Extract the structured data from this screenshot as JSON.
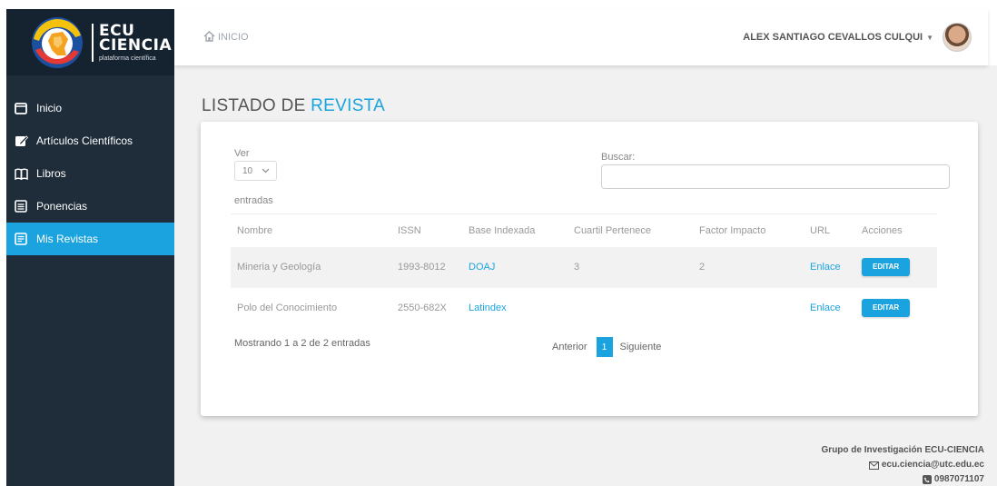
{
  "brand": {
    "line1": "ECU",
    "line2": "CIENCIA",
    "tagline": "plataforma científica"
  },
  "sidebar": {
    "items": [
      {
        "label": "Inicio",
        "icon": "square-icon"
      },
      {
        "label": "Artículos Científicos",
        "icon": "edit-icon"
      },
      {
        "label": "Libros",
        "icon": "book-icon"
      },
      {
        "label": "Ponencias",
        "icon": "list-icon"
      },
      {
        "label": "Mis Revistas",
        "icon": "document-icon",
        "active": true
      }
    ]
  },
  "header": {
    "breadcrumb": "INICIO",
    "user_name": "ALEX SANTIAGO CEVALLOS CULQUI"
  },
  "page": {
    "title_prefix": "LISTADO DE",
    "title_accent": "REVISTA"
  },
  "controls": {
    "show_label": "Ver",
    "page_size": "10",
    "entries_label": "entradas",
    "search_label": "Buscar:",
    "search_value": ""
  },
  "table": {
    "columns": [
      "Nombre",
      "ISSN",
      "Base Indexada",
      "Cuartil Pertenece",
      "Factor Impacto",
      "URL",
      "Acciones"
    ],
    "rows": [
      {
        "nombre": "Mineria y Geología",
        "issn": "1993-8012",
        "base": "DOAJ",
        "cuartil": "3",
        "factor": "2",
        "url": "Enlace",
        "action": "EDITAR"
      },
      {
        "nombre": "Polo del Conocimiento",
        "issn": "2550-682X",
        "base": "Latindex",
        "cuartil": "",
        "factor": "",
        "url": "Enlace",
        "action": "EDITAR"
      }
    ]
  },
  "pagination": {
    "info": "Mostrando 1 a 2 de 2 entradas",
    "prev": "Anterior",
    "current": "1",
    "next": "Siguiente"
  },
  "footer": {
    "group": "Grupo de Investigación ECU-CIENCIA",
    "email": "ecu.ciencia@utc.edu.ec",
    "phone": "0987071107"
  },
  "colors": {
    "accent": "#1aa3df",
    "sidebar": "#1f2d3a"
  }
}
